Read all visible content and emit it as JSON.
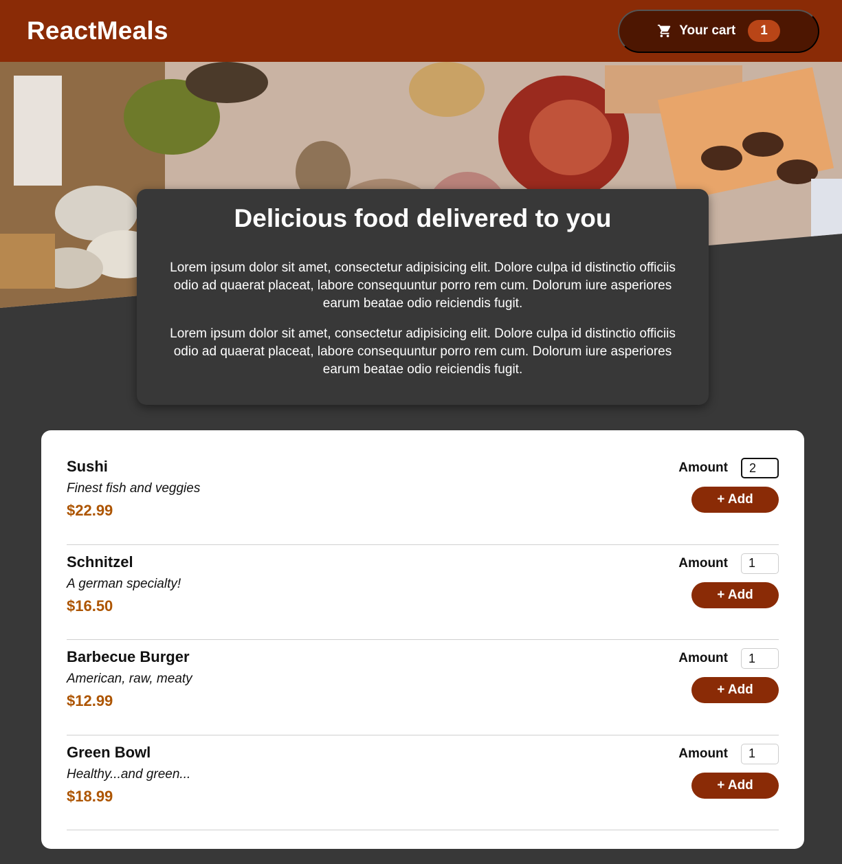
{
  "header": {
    "brand": "ReactMeals",
    "cart_label": "Your cart",
    "cart_count": "1",
    "cart_icon": "shopping-cart-icon"
  },
  "summary": {
    "title": "Delicious food delivered to you",
    "paragraphs": [
      "Lorem ipsum dolor sit amet, consectetur adipisicing elit. Dolore culpa id distinctio officiis odio ad quaerat placeat, labore consequuntur porro rem cum. Dolorum iure asperiores earum beatae odio reiciendis fugit.",
      "Lorem ipsum dolor sit amet, consectetur adipisicing elit. Dolore culpa id distinctio officiis odio ad quaerat placeat, labore consequuntur porro rem cum. Dolorum iure asperiores earum beatae odio reiciendis fugit."
    ]
  },
  "meals": [
    {
      "name": "Sushi",
      "description": "Finest fish and veggies",
      "price": "$22.99",
      "amount_label": "Amount",
      "amount": "2",
      "add_label": "+ Add"
    },
    {
      "name": "Schnitzel",
      "description": "A german specialty!",
      "price": "$16.50",
      "amount_label": "Amount",
      "amount": "1",
      "add_label": "+ Add"
    },
    {
      "name": "Barbecue Burger",
      "description": "American, raw, meaty",
      "price": "$12.99",
      "amount_label": "Amount",
      "amount": "1",
      "add_label": "+ Add"
    },
    {
      "name": "Green Bowl",
      "description": "Healthy...and green...",
      "price": "$18.99",
      "amount_label": "Amount",
      "amount": "1",
      "add_label": "+ Add"
    }
  ],
  "colors": {
    "header": "#8a2b06",
    "cart_button": "#4d1601",
    "badge": "#b94517",
    "background": "#383838",
    "price": "#ad5502"
  }
}
